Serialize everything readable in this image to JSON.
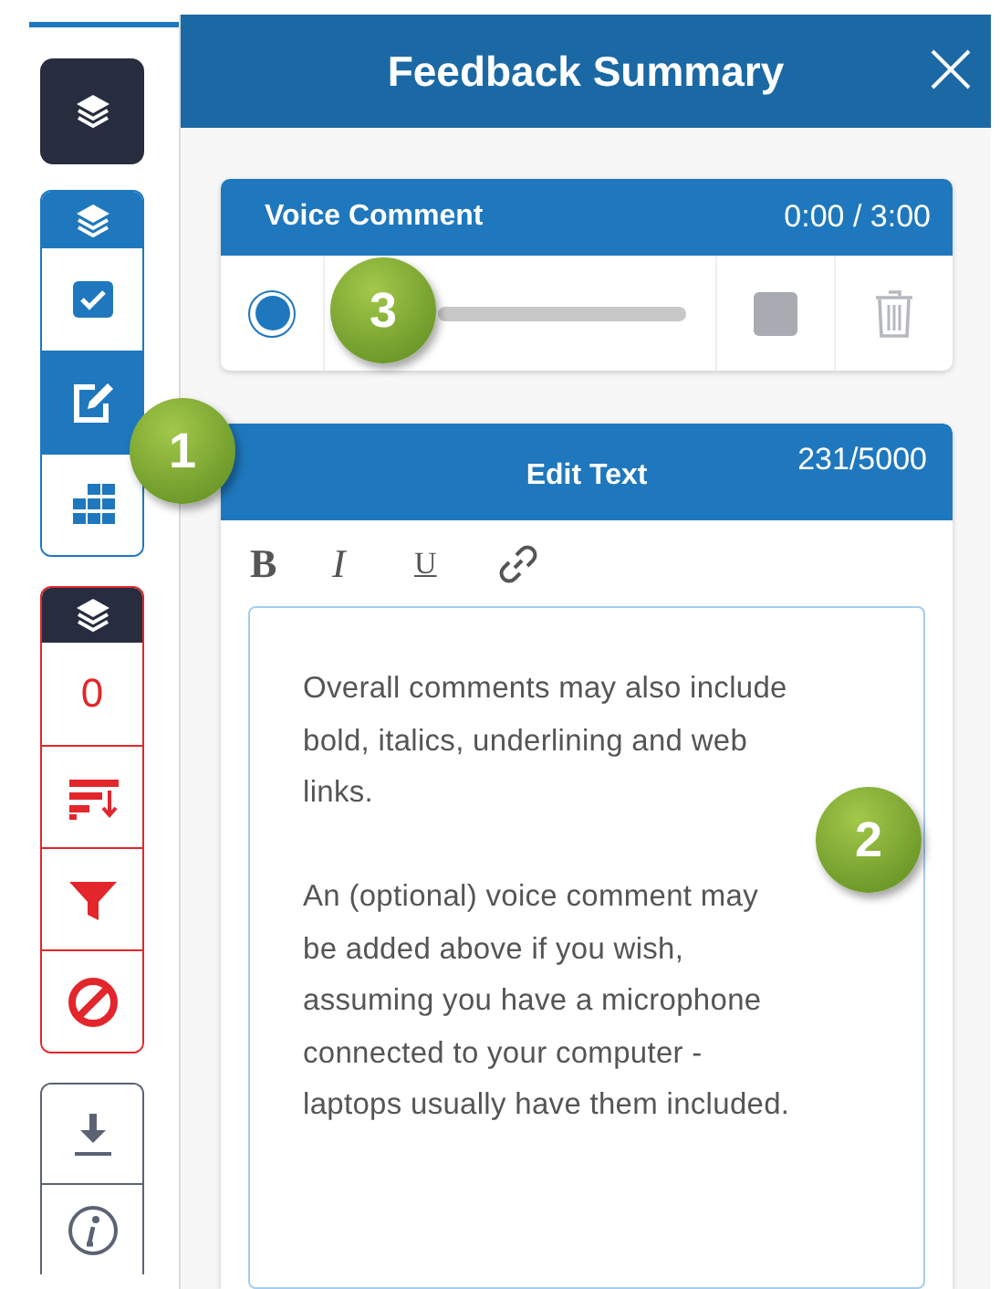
{
  "sidebar": {
    "top_button": {
      "kind": "layers"
    },
    "groups": [
      {
        "kind": "views",
        "tiles": [
          {
            "kind": "check",
            "selected": false
          },
          {
            "kind": "edit",
            "selected": true
          },
          {
            "kind": "grid",
            "selected": false
          }
        ]
      },
      {
        "kind": "filters",
        "tiles": [
          {
            "kind": "count",
            "text": "0",
            "selected": false
          },
          {
            "kind": "sort",
            "selected": false
          },
          {
            "kind": "filter",
            "selected": false
          },
          {
            "kind": "ban",
            "selected": false
          }
        ]
      },
      {
        "kind": "tools",
        "tiles": [
          {
            "kind": "download",
            "selected": false
          },
          {
            "kind": "info",
            "selected": false
          }
        ]
      }
    ]
  },
  "panel": {
    "title": "Feedback Summary",
    "voice_comment": {
      "title": "Voice Comment",
      "time": "0:00 / 3:00"
    },
    "editor": {
      "title": "Edit Text",
      "count": "231/5000",
      "format_buttons": [
        "B",
        "I",
        "U"
      ],
      "paragraphs": [
        [
          "Overall comments may also include",
          "bold, italics, underlining and web",
          "links."
        ],
        [
          "An (optional) voice comment may",
          "be added above if you wish,",
          "assuming you have a microphone",
          "connected to your computer -",
          "laptops usually have them included."
        ]
      ]
    }
  },
  "callouts": [
    {
      "text": "1"
    },
    {
      "text": "2"
    },
    {
      "text": "3"
    }
  ]
}
